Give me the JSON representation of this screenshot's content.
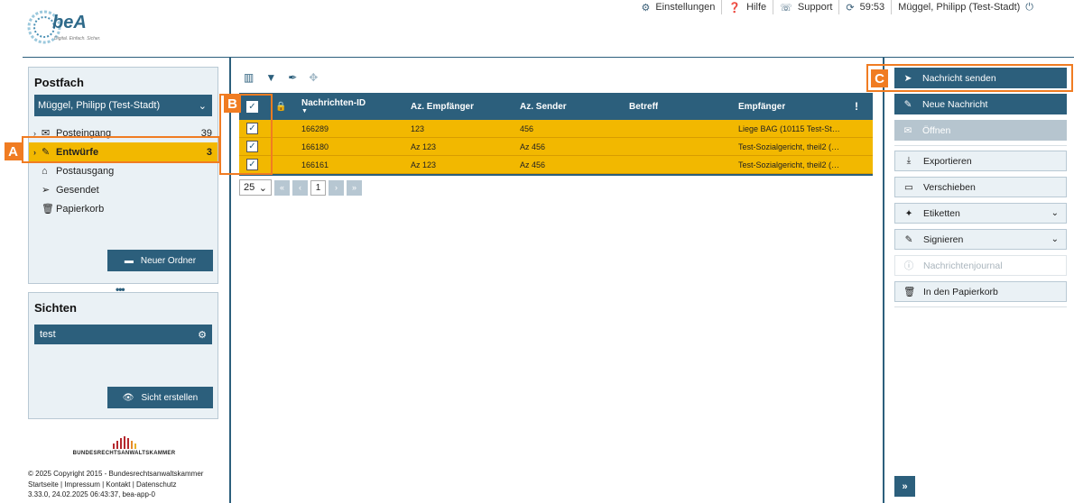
{
  "logo": {
    "text": "beA",
    "tagline": "Digital. Einfach. Sicher."
  },
  "topnav": {
    "settings": "Einstellungen",
    "help": "Hilfe",
    "support": "Support",
    "session": "59:53",
    "user": "Müggel, Philipp (Test-Stadt)"
  },
  "postfach": {
    "title": "Postfach",
    "selected_mailbox": "Müggel, Philipp (Test-Stadt)",
    "folders": [
      {
        "label": "Posteingang",
        "count": "39"
      },
      {
        "label": "Entwürfe",
        "count": "3"
      },
      {
        "label": "Postausgang",
        "count": ""
      },
      {
        "label": "Gesendet",
        "count": ""
      },
      {
        "label": "Papierkorb",
        "count": ""
      }
    ],
    "new_folder": "Neuer Ordner"
  },
  "sichten": {
    "title": "Sichten",
    "items": [
      "test"
    ],
    "create": "Sicht erstellen"
  },
  "bak": {
    "name": "BUNDESRECHTSANWALTSKAMMER"
  },
  "footer": {
    "line1": "© 2025 Copyright 2015 - Bundesrechtsanwaltskammer",
    "line2": "Startseite | Impressum | Kontakt | Datenschutz",
    "line3": "3.33.0, 24.02.2025 06:43:37, bea-app-0"
  },
  "table": {
    "columns": {
      "id": "Nachrichten-ID",
      "az_empf": "Az. Empfänger",
      "az_send": "Az. Sender",
      "betreff": "Betreff",
      "empf": "Empfänger",
      "flag": "!"
    },
    "rows": [
      {
        "id": "166289",
        "az_empf": "123",
        "az_send": "456",
        "betreff": "",
        "empf": "Liege BAG (10115 Test-St…"
      },
      {
        "id": "166180",
        "az_empf": "Az 123",
        "az_send": "Az 456",
        "betreff": "",
        "empf": "Test-Sozialgericht, theil2 (…"
      },
      {
        "id": "166161",
        "az_empf": "Az 123",
        "az_send": "Az 456",
        "betreff": "",
        "empf": "Test-Sozialgericht, theil2 (…"
      }
    ]
  },
  "pager": {
    "page_size": "25",
    "page": "1"
  },
  "actions": {
    "send": "Nachricht senden",
    "new": "Neue Nachricht",
    "open": "Öffnen",
    "export": "Exportieren",
    "move": "Verschieben",
    "labels": "Etiketten",
    "sign": "Signieren",
    "journal": "Nachrichtenjournal",
    "trash": "In den Papierkorb"
  },
  "annotations": {
    "a": "A",
    "b": "B",
    "c": "C"
  },
  "colors": {
    "primary": "#2c5f7c",
    "highlight": "#f2b800",
    "annotation": "#f07c22"
  }
}
